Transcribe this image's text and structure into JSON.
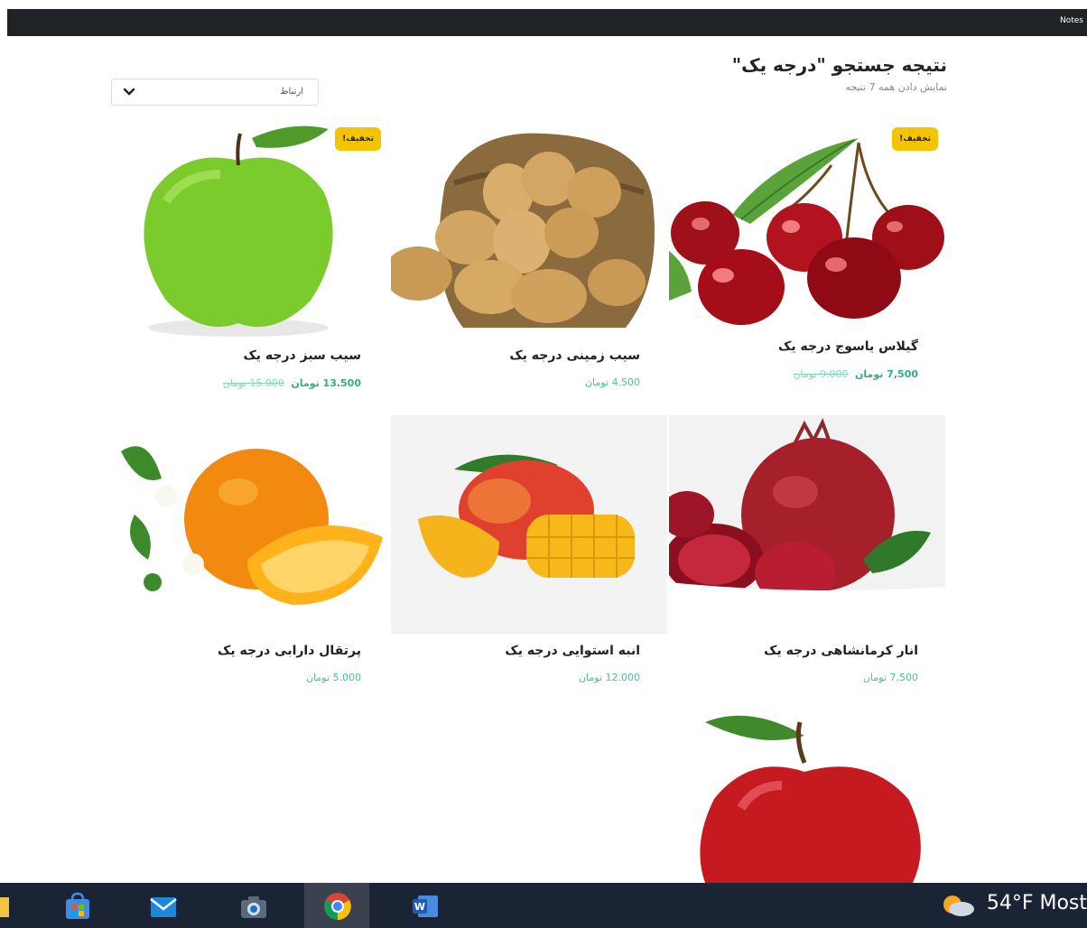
{
  "topbar": {
    "notes_label": "Notes"
  },
  "header": {
    "title": "نتیجه جستجو \"درجه یک\"",
    "subtitle": "نمایش دادن همه 7 نتیجه"
  },
  "sort": {
    "selected": "ارتباط"
  },
  "products": [
    {
      "name": "گیلاس یاسوج درجه یک",
      "old_price": "9.000 تومان",
      "price": "7,500 تومان",
      "badge": "تخفیف!"
    },
    {
      "name": "سیب زمینی درجه یک",
      "price": "4.500 تومان"
    },
    {
      "name": "سیب سبز درجه یک",
      "old_price": "15.000 تومان",
      "price": "13.500 تومان",
      "badge": "تخفیف!"
    },
    {
      "name": "انار کرمانشاهی درجه یک",
      "price": "7,500 تومان"
    },
    {
      "name": "انبه استوایی درجه یک",
      "price": "12.000 تومان"
    },
    {
      "name": "پرتقال دارابی درجه یک",
      "price": "5.000 تومان"
    }
  ],
  "taskbar": {
    "weather": "54°F Most",
    "icons": [
      "folder-icon",
      "store-icon",
      "mail-icon",
      "camera-icon",
      "chrome-icon",
      "word-icon"
    ]
  }
}
